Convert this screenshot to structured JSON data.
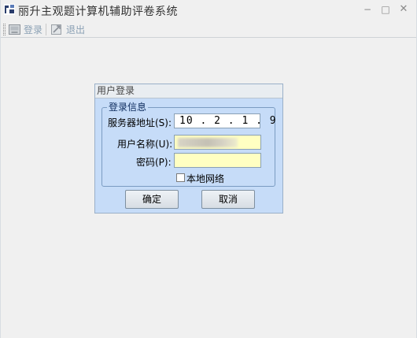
{
  "window": {
    "title": "丽升主观题计算机辅助评卷系统",
    "minimize": "−",
    "maximize": "□",
    "close": "✕"
  },
  "toolbar": {
    "login_label": "登录",
    "logout_label": "退出"
  },
  "dialog": {
    "title": "用户登录",
    "group_label": "登录信息",
    "server_label": "服务器地址(S):",
    "server_value": "10.2.1.9",
    "username_label": "用户名称(U):",
    "username_value": "",
    "password_label": "密码(P):",
    "password_value": "",
    "local_network_label": "本地网络",
    "local_network_checked": false,
    "ok_label": "确定",
    "cancel_label": "取消"
  },
  "colors": {
    "dialog_background": "#c6dcf8",
    "input_highlight": "#ffffc2",
    "group_border": "#7b9cc2"
  }
}
